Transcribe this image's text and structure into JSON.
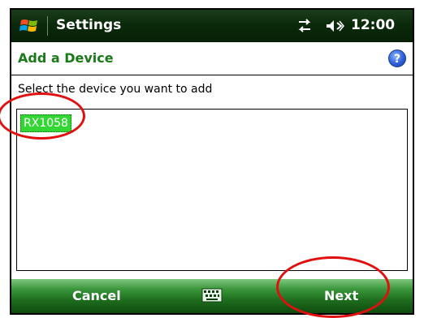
{
  "titlebar": {
    "app_title": "Settings",
    "time": "12:00",
    "icons": {
      "start": "windows-start-icon",
      "connectivity": "connectivity-icon",
      "volume": "volume-icon"
    }
  },
  "header": {
    "title": "Add a Device",
    "help_icon": "help-icon",
    "help_glyph": "?"
  },
  "content": {
    "prompt": "Select the device you want to add",
    "devices": [
      "RX1058"
    ],
    "selected_index": 0
  },
  "softkeys": {
    "left": "Cancel",
    "right": "Next",
    "keyboard_icon": "keyboard-icon"
  },
  "colors": {
    "title_bg": "#0b2a0b",
    "header_text": "#1a7a1a",
    "selection": "#33d633",
    "annotation": "#e01010",
    "softkey_bar": "#3a963a"
  }
}
